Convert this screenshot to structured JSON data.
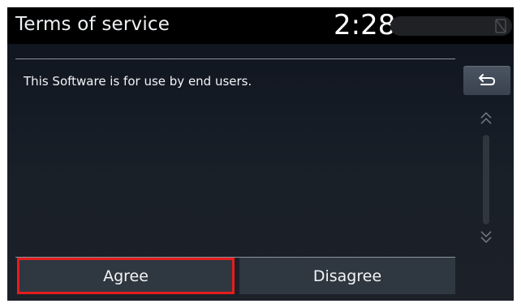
{
  "header": {
    "title": "Terms of service",
    "clock": "2:28",
    "status_icon": "no-signal-icon"
  },
  "content": {
    "text": "This Software is for use by end users."
  },
  "controls": {
    "back_icon": "back-arrow-icon",
    "scroll_up_icon": "double-chevron-up-icon",
    "scroll_down_icon": "double-chevron-down-icon"
  },
  "buttons": {
    "agree_label": "Agree",
    "disagree_label": "Disagree",
    "selected": "Agree"
  },
  "colors": {
    "selection_border": "#e51d1d",
    "button_bg": "#2f3740",
    "header_bg": "#000000"
  }
}
